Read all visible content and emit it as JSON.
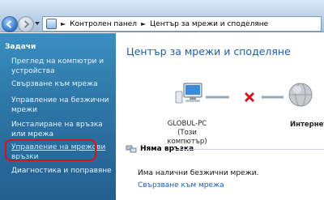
{
  "address": {
    "crumbs": [
      "Контролен панел",
      "Център за мрежи и споделяне"
    ]
  },
  "sidebar": {
    "title": "Задачи",
    "items": [
      {
        "label": "Преглед на компютри и устройства"
      },
      {
        "label": "Свързване към мрежа"
      },
      {
        "label": "Управление на безжични мрежи"
      },
      {
        "label": "Инсталиране на връзка или мрежа"
      },
      {
        "label": "Управление на мрежови връзки"
      },
      {
        "label": "Диагностика и поправяне"
      }
    ]
  },
  "main": {
    "title": "Център за мрежи и споделяне",
    "computer_name": "GLOBUL-PC",
    "computer_sub": "(Този компютър)",
    "internet_label": "Интернет",
    "section_header": "Няма връзка",
    "status_text": "Има налични безжични мрежи.",
    "connect_link": "Свързване към мрежа"
  },
  "colors": {
    "accent_link": "#1d5fa8",
    "highlight": "#d7121f",
    "sidebar_bg": "#2e77a8"
  }
}
